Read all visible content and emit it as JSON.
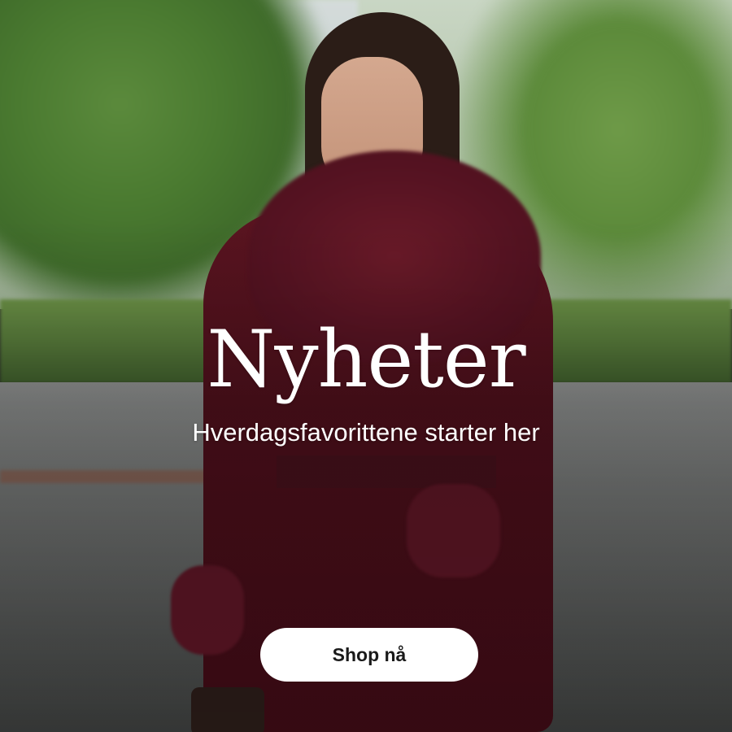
{
  "banner": {
    "headline": "Nyheter",
    "subline": "Hverdagsfavorittene starter her",
    "cta_label": "Shop nå"
  },
  "colors": {
    "text": "#ffffff",
    "button_bg": "#ffffff",
    "button_text": "#1a1a1a",
    "coat": "#4b0f1a"
  }
}
